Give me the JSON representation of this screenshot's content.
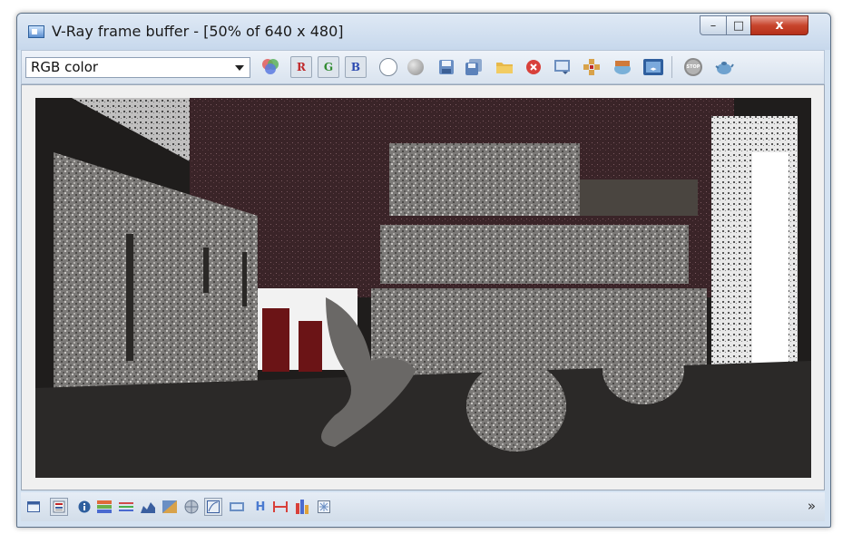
{
  "window": {
    "title": "V-Ray frame buffer - [50% of 640 x 480]",
    "close_glyph": "x",
    "max_glyph": "□",
    "min_glyph": "–"
  },
  "toolbar": {
    "channel_select": {
      "value": "RGB color"
    },
    "red_channel_label": "R",
    "green_channel_label": "G",
    "blue_channel_label": "B",
    "stop_label": "STOP",
    "icons": [
      "color-correction-icon",
      "red-channel-icon",
      "green-channel-icon",
      "blue-channel-icon",
      "white-display-icon",
      "mono-display-icon",
      "save-image-icon",
      "save-all-images-icon",
      "load-image-icon",
      "clear-image-icon",
      "duplicate-to-max-fb-icon",
      "track-mouse-icon",
      "region-render-icon",
      "render-icon",
      "stop-render-icon",
      "teapot-render-icon"
    ]
  },
  "statusbar": {
    "h_label": "H",
    "expand_glyph": "»",
    "icons": [
      "display-window-icon",
      "history-icon",
      "info-icon",
      "hsv-correction-icon",
      "levels-icon",
      "curve-icon",
      "exposure-icon",
      "background-icon",
      "srgb-icon",
      "lut-icon",
      "horizontal-flip-icon",
      "vertical-flip-icon",
      "show-corrections-icon",
      "lens-effects-icon"
    ]
  },
  "colors": {
    "window_frame": "#d4e2f1",
    "close_button": "#c8452d",
    "render_background": "#1f1d1c",
    "vase_red": "#6b1416",
    "wall_maroon": "#3a2428"
  }
}
